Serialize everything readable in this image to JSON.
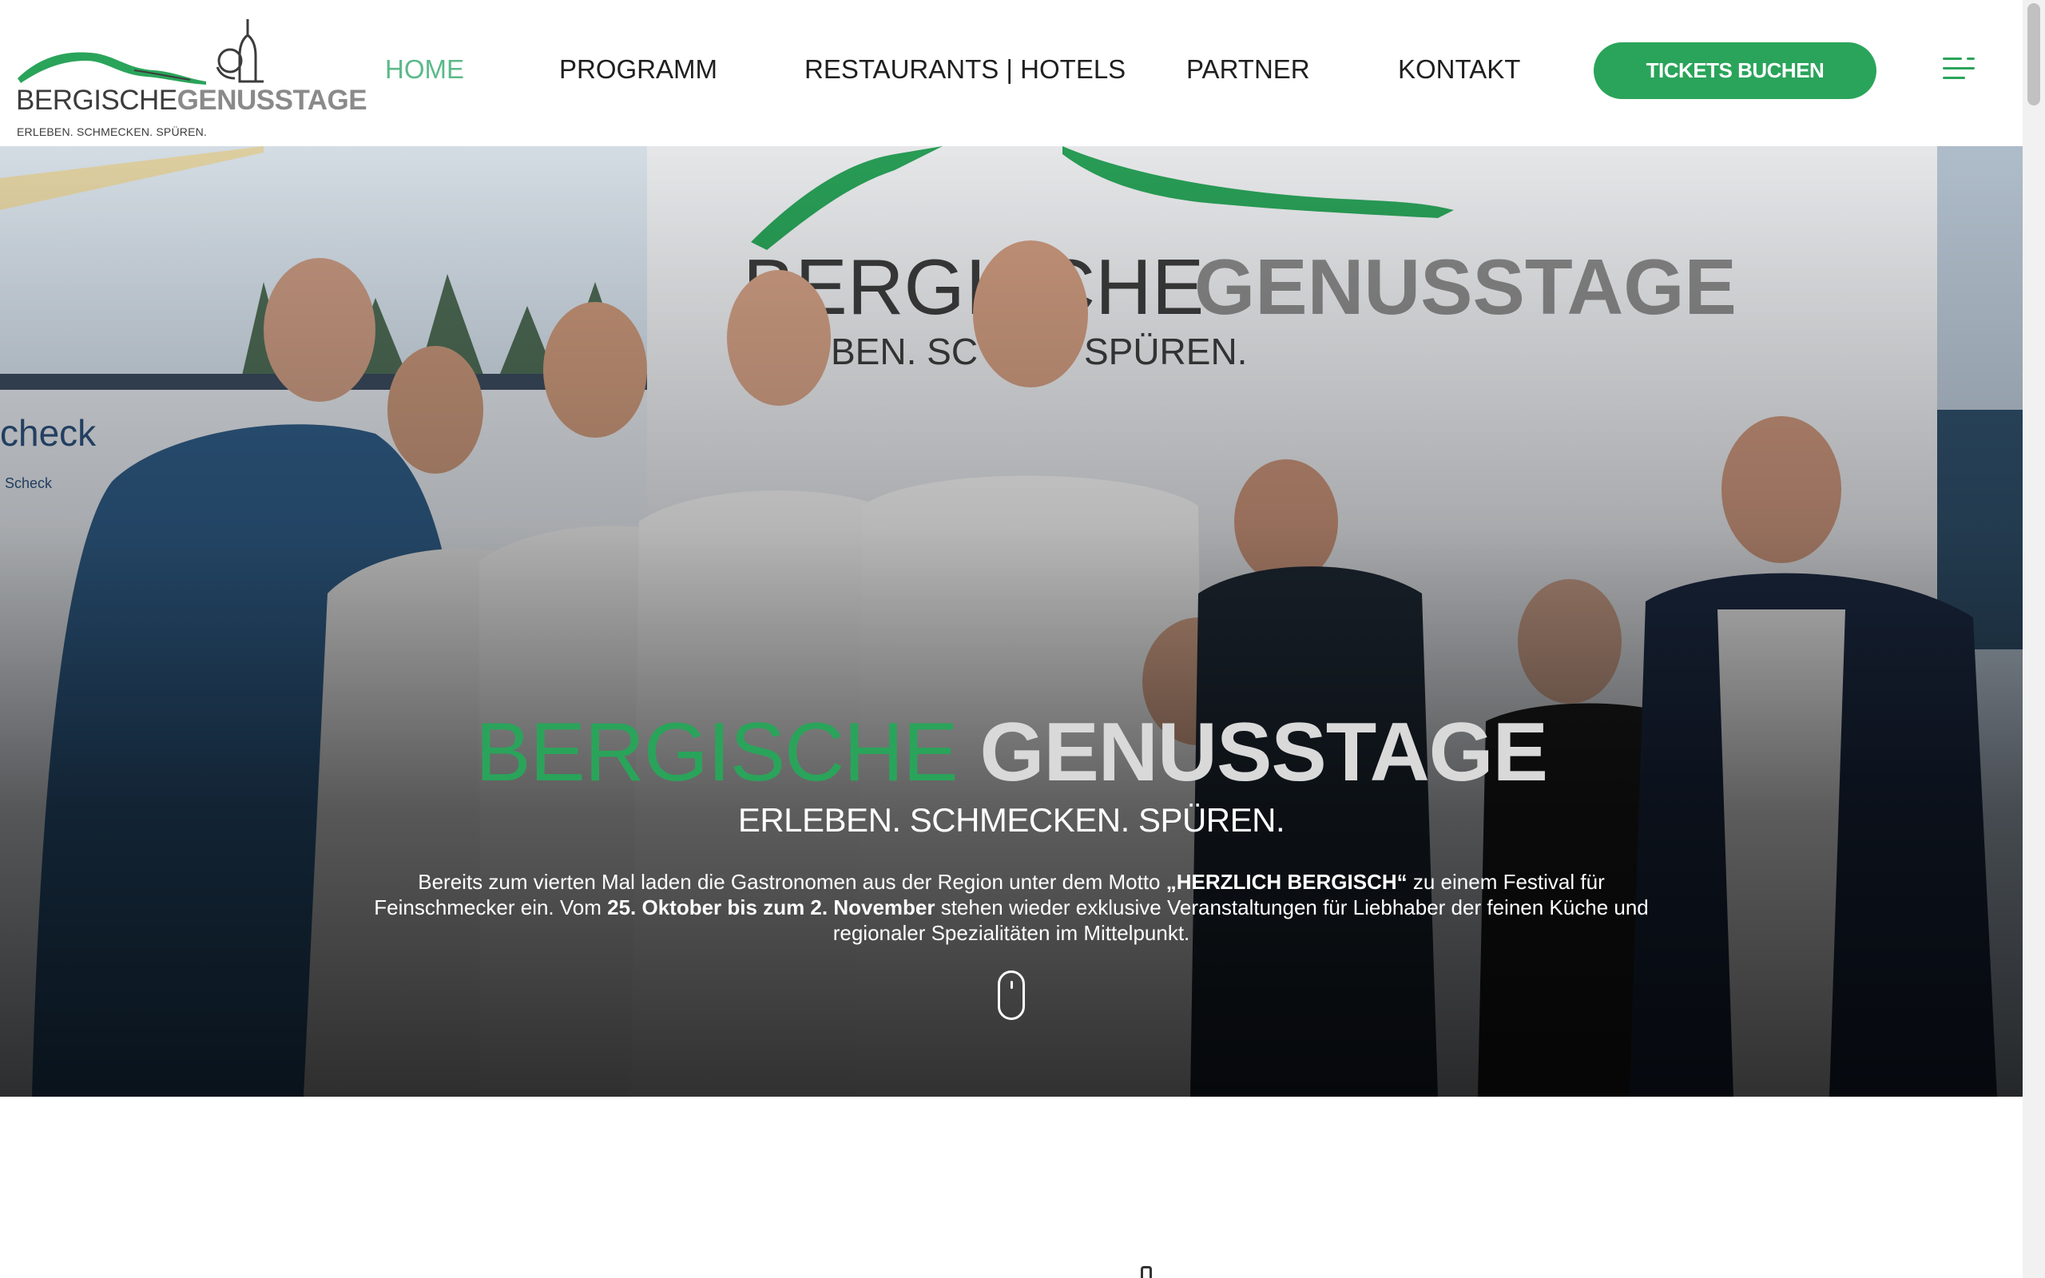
{
  "logo": {
    "word1": "BERGISCHE",
    "word2": "GENUSSTAGE",
    "tagline": "ERLEBEN. SCHMECKEN. SPÜREN."
  },
  "nav": {
    "items": [
      {
        "label": "HOME",
        "active": true
      },
      {
        "label": "PROGRAMM",
        "active": false
      },
      {
        "label": "RESTAURANTS | HOTELS",
        "active": false
      },
      {
        "label": "PARTNER",
        "active": false
      },
      {
        "label": "KONTAKT",
        "active": false
      }
    ],
    "tickets_label": "TICKETS BUCHEN",
    "menu_icon": "hamburger-menu-icon"
  },
  "hero": {
    "title_word1": "BERGISCHE",
    "title_word2": "GENUSSTAGE",
    "subtitle": "ERLEBEN. SCHMECKEN. SPÜREN.",
    "text_part1": "Bereits zum vierten Mal laden die Gastronomen aus der Region unter dem Motto ",
    "text_bold1": "„HERZLICH BERGISCH“",
    "text_part2": " zu einem Festival für Feinschmecker ein. Vom ",
    "text_bold2": "25. Oktober bis zum 2. November",
    "text_part3": " stehen wieder exklusive Veranstaltungen für Liebhaber der feinen Küche und regionaler Spezialitäten im Mittelpunkt.",
    "banner_word1": "BERGISCHE",
    "banner_word2": "GENUSSTAGE",
    "banner_tagline": "BEN. SC     KEN. SPÜREN.",
    "sign_text": "check",
    "sign_small": "Scheck",
    "scroll_icon": "mouse-scroll-icon"
  },
  "colors": {
    "brand_green": "#2aa45a",
    "nav_active": "#5cb98a",
    "logo_grey": "#8a8a8a"
  }
}
